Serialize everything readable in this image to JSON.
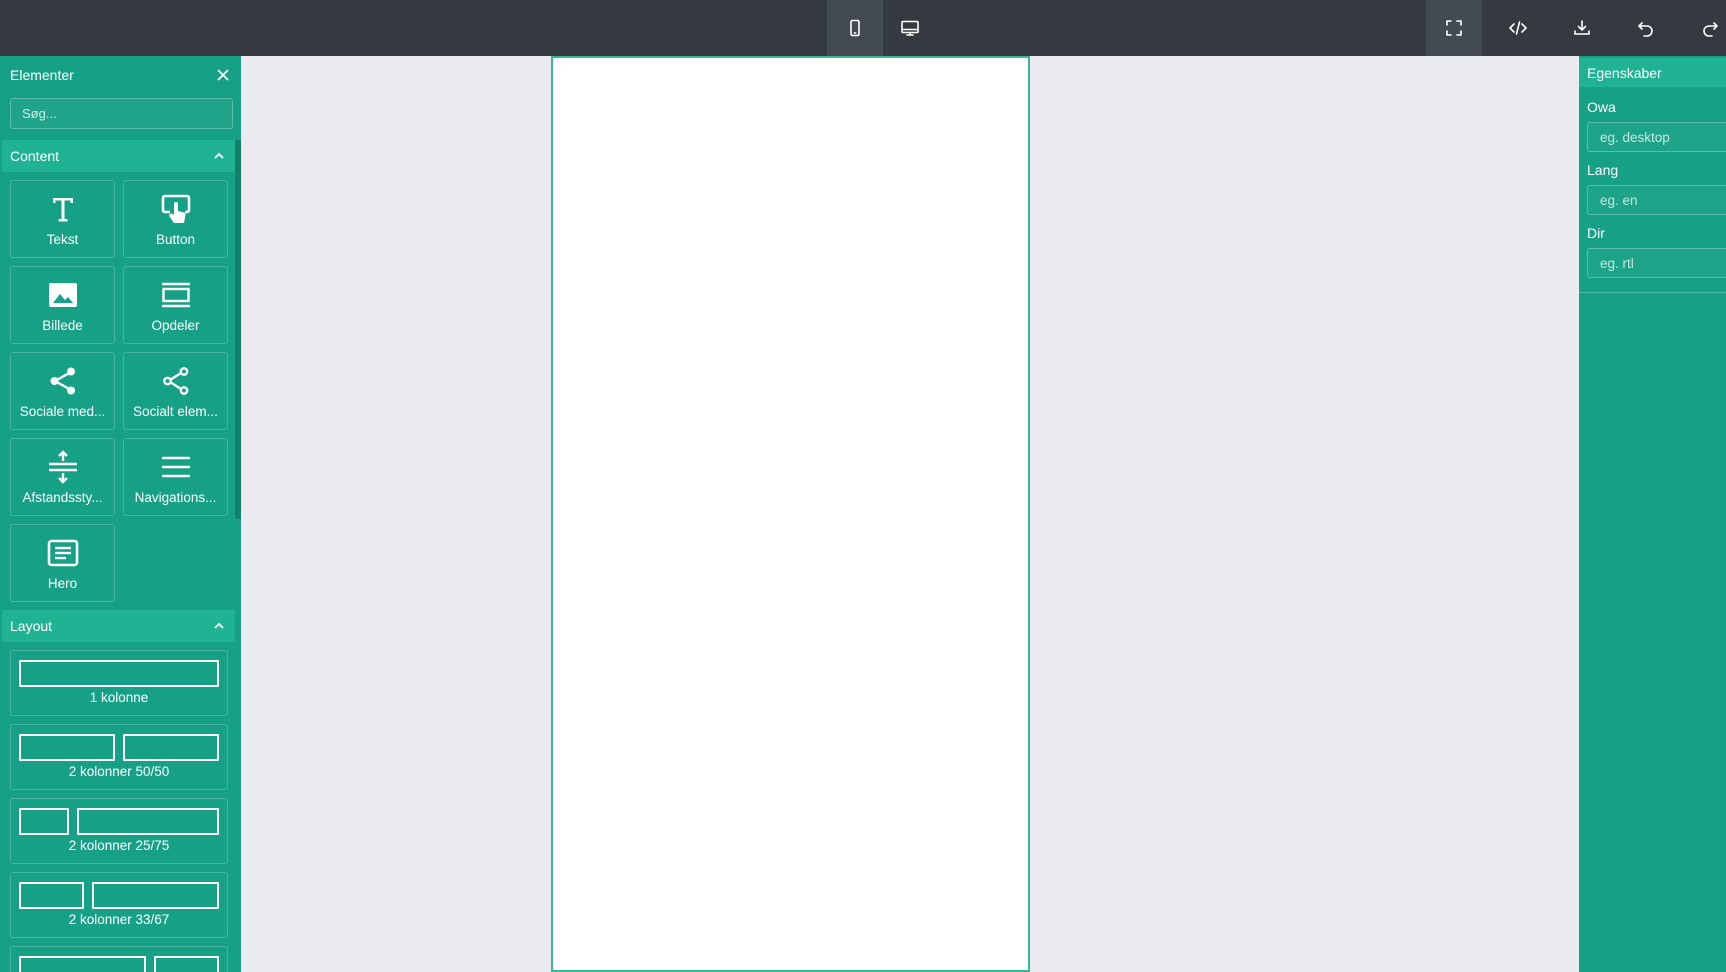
{
  "topbar": {
    "device_buttons": [
      {
        "name": "mobile",
        "active": true
      },
      {
        "name": "desktop",
        "active": false
      }
    ],
    "action_buttons": [
      "fullscreen",
      "code",
      "import",
      "undo",
      "redo"
    ]
  },
  "left_panel": {
    "title": "Elementer",
    "search_placeholder": "Søg...",
    "categories": {
      "content": {
        "label": "Content",
        "blocks": [
          {
            "label": "Tekst",
            "icon": "text-icon"
          },
          {
            "label": "Button",
            "icon": "button-click-icon"
          },
          {
            "label": "Billede",
            "icon": "image-icon"
          },
          {
            "label": "Opdeler",
            "icon": "divider-icon"
          },
          {
            "label": "Sociale med...",
            "icon": "share-icon"
          },
          {
            "label": "Socialt elem...",
            "icon": "share-outline-icon"
          },
          {
            "label": "Afstandssty...",
            "icon": "spacer-icon"
          },
          {
            "label": "Navigations...",
            "icon": "menu-icon"
          },
          {
            "label": "Hero",
            "icon": "hero-icon"
          }
        ]
      },
      "layout": {
        "label": "Layout",
        "blocks": [
          {
            "label": "1 kolonne",
            "ratios": [
              1
            ]
          },
          {
            "label": "2 kolonner 50/50",
            "ratios": [
              1,
              1
            ]
          },
          {
            "label": "2 kolonner 25/75",
            "ratios": [
              1,
              3
            ]
          },
          {
            "label": "2 kolonner 33/67",
            "ratios": [
              1,
              2
            ]
          },
          {
            "label": "",
            "ratios": [
              2,
              1
            ]
          }
        ]
      }
    }
  },
  "right_panel": {
    "title": "Egenskaber",
    "fields": [
      {
        "label": "Owa",
        "placeholder": "eg. desktop"
      },
      {
        "label": "Lang",
        "placeholder": "eg. en"
      },
      {
        "label": "Dir",
        "placeholder": "eg. rtl"
      }
    ]
  }
}
